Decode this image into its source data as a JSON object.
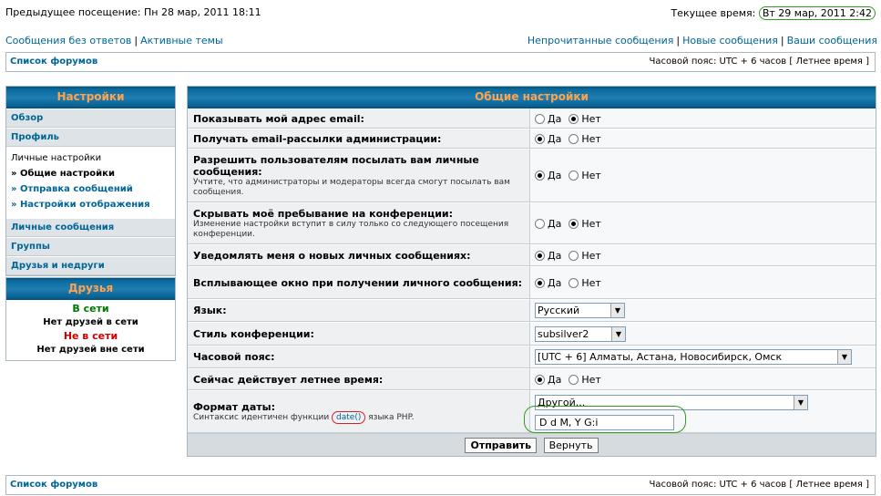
{
  "header": {
    "last_visit": "Предыдущее посещение: Пн 28 мар, 2011 18:11",
    "current_time_label": "Текущее время:",
    "current_time": "Вт 29 мар, 2011 2:42"
  },
  "links": {
    "unanswered": "Сообщения без ответов",
    "active": "Активные темы",
    "unread": "Непрочитанные сообщения",
    "new": "Новые сообщения",
    "yours": "Ваши сообщения",
    "separator": "|"
  },
  "navbar": {
    "forum_list": "Список форумов",
    "timezone": "Часовой пояс: UTC + 6 часов [ Летнее время ]"
  },
  "sidebar": {
    "title": "Настройки",
    "overview": "Обзор",
    "profile": "Профиль",
    "personal_header": "Личные настройки",
    "general": "» Общие настройки",
    "posting": "» Отправка сообщений",
    "display": "» Настройки отображения",
    "pm": "Личные сообщения",
    "groups": "Группы",
    "friends_foes": "Друзья и недруги"
  },
  "friends": {
    "title": "Друзья",
    "online": "В сети",
    "none_online": "Нет друзей в сети",
    "offline": "Не в сети",
    "none_offline": "Нет друзей вне сети"
  },
  "main": {
    "title": "Общие настройки",
    "yes": "Да",
    "no": "Нет",
    "rows": [
      {
        "label": "Показывать мой адрес email:",
        "explain": "",
        "selected": "no"
      },
      {
        "label": "Получать email-рассылки администрации:",
        "explain": "",
        "selected": "yes"
      },
      {
        "label": "Разрешить пользователям посылать вам личные сообщения:",
        "explain": "Учтите, что администраторы и модераторы всегда смогут посылать вам сообщения.",
        "selected": "yes"
      },
      {
        "label": "Скрывать моё пребывание на конференции:",
        "explain": "Изменение настройки вступит в силу только со следующего посещения конференции.",
        "selected": "no"
      },
      {
        "label": "Уведомлять меня о новых личных сообщениях:",
        "explain": "",
        "selected": "yes"
      },
      {
        "label": "Всплывающее окно при получении личного сообщения:",
        "explain": "",
        "selected": "yes"
      }
    ],
    "language_label": "Язык:",
    "language_value": "Русский",
    "style_label": "Стиль конференции:",
    "style_value": "subsilver2",
    "tz_label": "Часовой пояс:",
    "tz_value": "[UTC + 6] Алматы, Астана, Новосибирск, Омск",
    "dst_label": "Сейчас действует летнее время:",
    "dst_selected": "yes",
    "date_label": "Формат даты:",
    "date_explain_pre": "Синтаксис идентичен функции",
    "date_func": "date()",
    "date_explain_post": "языка PHP.",
    "date_select": "Другой...",
    "date_value": "D d M, Y G:i",
    "submit": "Отправить",
    "reset": "Вернуть"
  }
}
